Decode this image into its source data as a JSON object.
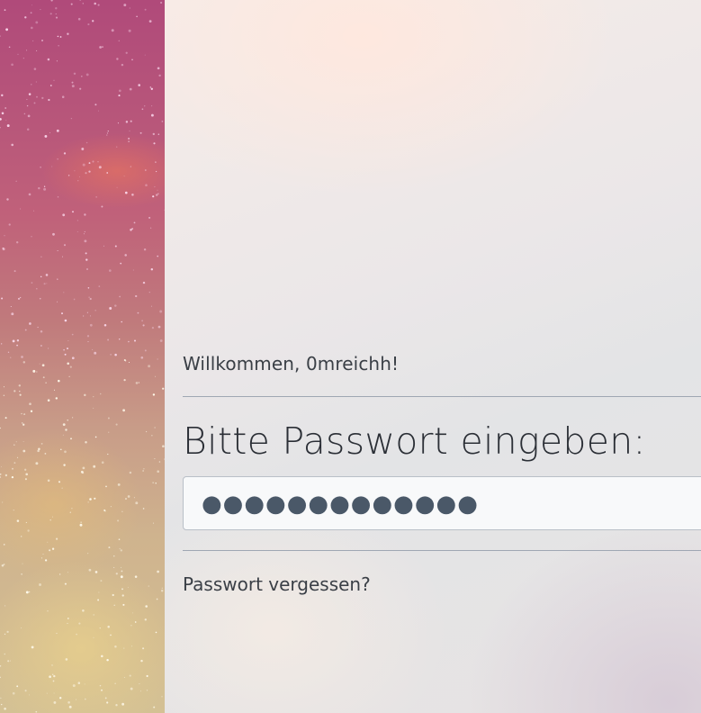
{
  "login": {
    "welcome_text": "Willkommen, 0mreichh!",
    "prompt_text": "Bitte Passwort eingeben:",
    "password_masked": "●●●●●●●●●●●●●",
    "forgot_link": "Passwort vergessen?"
  },
  "colors": {
    "text": "#3a3f46",
    "heading": "#2b2f36",
    "divider": "#9fa7b3",
    "mask_dots": "#4a5868",
    "input_bg": "#f8f9fa"
  },
  "icons": {
    "background_panel": "glitter-background-image"
  }
}
